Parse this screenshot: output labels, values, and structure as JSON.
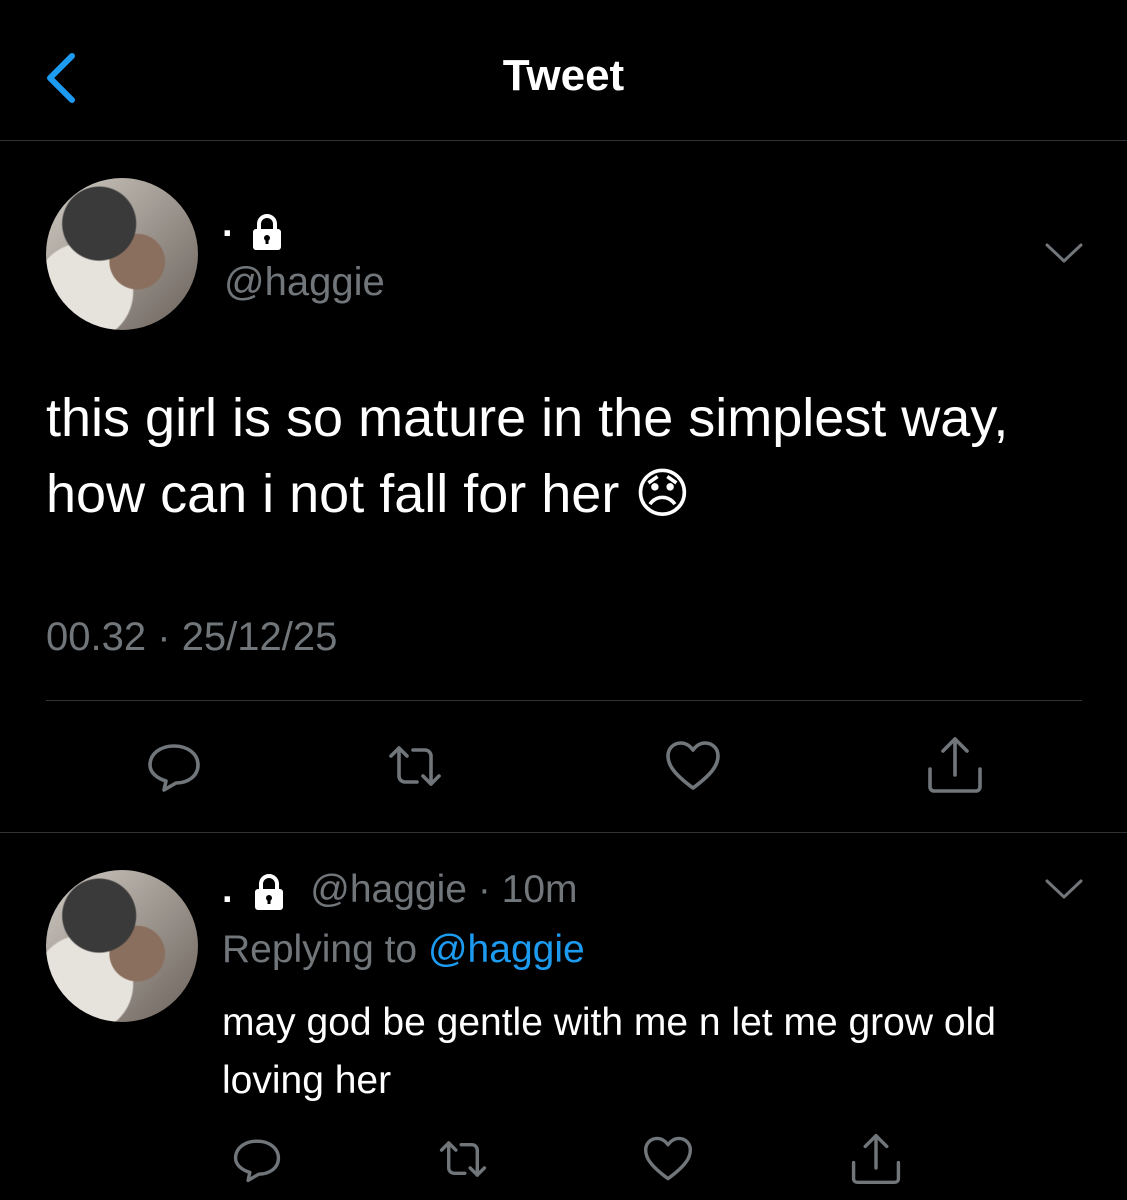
{
  "header": {
    "title": "Tweet"
  },
  "tweet": {
    "display_name": ".",
    "handle": "@haggie",
    "text": "this girl is so mature in the simplest way, how can i not fall for her 😞",
    "time": "00.32",
    "separator": "·",
    "date": "25/12/25"
  },
  "reply": {
    "display_name": ".",
    "handle": "@haggie",
    "separator": "·",
    "age": "10m",
    "replying_label": "Replying to",
    "replying_handle": "@haggie",
    "text": "may god be gentle with me n let me grow old loving her"
  },
  "icons": [
    "back-chevron-icon",
    "lock-icon",
    "chevron-down-icon",
    "reply-icon",
    "retweet-icon",
    "like-icon",
    "share-icon"
  ],
  "colors": {
    "background": "#000000",
    "accent": "#1d9bf0",
    "secondary": "#71767b",
    "divider": "#2f3336"
  }
}
